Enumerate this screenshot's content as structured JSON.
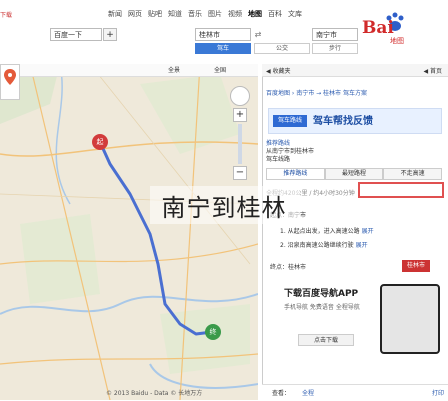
{
  "top": {
    "left_notice": "下载",
    "nav_items": [
      "新闻",
      "网页",
      "贴吧",
      "知道",
      "音乐",
      "图片",
      "视频",
      "地图",
      "百科",
      "文库"
    ],
    "nav_active_index": 7,
    "search_value": "百度一下",
    "route_from": "南宁市",
    "route_to": "桂林市",
    "swap_label": "⇄",
    "tab_drive": "驾车",
    "tab_bus": "公交",
    "tab_walk": "步行",
    "logo_text": "Bai",
    "logo_sub": "地图"
  },
  "map": {
    "toolbar_left": "全国",
    "toolbar_right": "全景",
    "start_marker": "起",
    "end_marker": "终",
    "footer": "© 2013 Baidu - Data © 长地万方"
  },
  "panel": {
    "header_left": "◀ 收藏夹",
    "header_right": "◀ 首页",
    "route_line": "百度地图 › 南宁市 → 桂林市 驾车方案",
    "ad_button": "驾车路线",
    "ad_title": "驾车帮找反馈",
    "summary_link": "推荐路线",
    "summary_text": "从南宁市到桂林市",
    "summary_sub": "驾车线路",
    "strategy_tabs": [
      "推荐路线",
      "最短路程",
      "不走高速"
    ],
    "strategy_active": 0,
    "distance_text": "全程约420公里 / 约4小时30分钟",
    "start_label": "起点：南宁市",
    "step1": "1. 从起点出发，进入高速公路",
    "step2": "2. 沿泉南高速公路继续行驶",
    "step_link": "展开",
    "end_badge": "桂林市",
    "end_label": "终点：桂林市",
    "app_title": "下载百度导航APP",
    "app_sub": "手机导航 免费语音 全程导航",
    "app_button": "点击下载",
    "footer_a": "查看：",
    "footer_b": "全程",
    "footer_c": "打印"
  },
  "caption": "南宁到桂林",
  "colors": {
    "route": "#4a6fd1",
    "accent_red": "#c33",
    "map_bg": "#efe9da",
    "water": "#a9c8e8",
    "roads": "#f2c37a"
  }
}
